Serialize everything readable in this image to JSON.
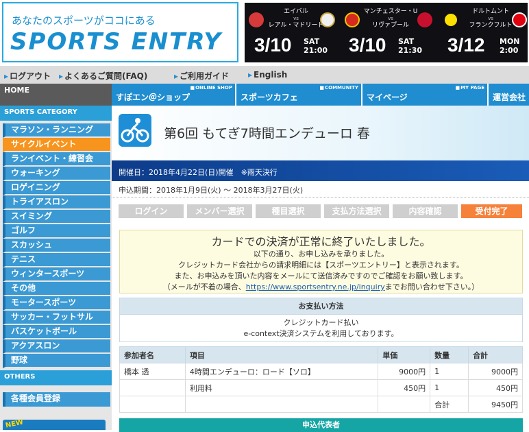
{
  "header": {
    "tagline": "あなたのスポーツがココにある",
    "logo": "SPORTS ENTRY",
    "banner": [
      {
        "home": "エイバル",
        "away": "レアル・マドリード",
        "vs": "vs",
        "date": "3/10",
        "day": "SAT",
        "time": "21:00",
        "crest_a": "#d63a3a",
        "crest_b": "#f0f0f0"
      },
      {
        "home": "マンチェスター・U",
        "away": "リヴァプール",
        "vs": "vs",
        "date": "3/10",
        "day": "SAT",
        "time": "21:30",
        "crest_a": "#d52b1e",
        "crest_b": "#c8102e"
      },
      {
        "home": "ドルトムント",
        "away": "フランクフルト",
        "vs": "vs",
        "date": "3/12",
        "day": "MON",
        "time": "2:00",
        "crest_a": "#fde100",
        "crest_b": "#e1000f"
      }
    ]
  },
  "util": {
    "logout": "ログアウト",
    "faq": "よくあるご質問(FAQ)",
    "guide": "ご利用ガイド",
    "english": "English"
  },
  "sidebar": {
    "home": "HOME",
    "category_head": "SPORTS CATEGORY",
    "categories": [
      "マラソン・ランニング",
      "サイクルイベント",
      "ランイベント・練習会",
      "ウォーキング",
      "ロゲイニング",
      "トライアスロン",
      "スイミング",
      "ゴルフ",
      "スカッシュ",
      "テニス",
      "ウィンタースポーツ",
      "その他",
      "モータースポーツ",
      "サッカー・フットサル",
      "バスケットボール",
      "アクアスロン",
      "野球"
    ],
    "others_head": "OTHERS",
    "register": "各種会員登録",
    "new_badge": "NEW"
  },
  "nav": [
    {
      "sub": "ONLINE SHOP",
      "label": "すぽエン＠ショップ"
    },
    {
      "sub": "COMMUNITY",
      "label": "スポーツカフェ"
    },
    {
      "sub": "MY PAGE",
      "label": "マイページ"
    },
    {
      "sub": "",
      "label": "運営会社"
    }
  ],
  "event": {
    "title": "第6回 もてぎ7時間エンデューロ 春",
    "date_line": "開催日：2018年4月22日(日)開催　※雨天決行",
    "period": "申込期間：2018年1月9日(火) 〜 2018年3月27日(火)"
  },
  "steps": [
    "ログイン",
    "メンバー選択",
    "種目選択",
    "支払方法選択",
    "内容確認",
    "受付完了"
  ],
  "success": {
    "title": "カードでの決済が正常に終了いたしました。",
    "lines": [
      "以下の通り、お申し込みを承りました。",
      "クレジットカード会社からの請求明細には【スポーツエントリー】と表示されます。",
      "また、お申込みを頂いた内容をメールにて送信済みですのでご確認をお願い致します。"
    ],
    "line4_before": "（メールが不着の場合、",
    "line4_link": "https://www.sportsentry.ne.jp/inquiry",
    "line4_after": "までお問い合わせ下さい。）"
  },
  "payment": {
    "head": "お支払い方法",
    "method": "クレジットカード払い",
    "note": "e-context決済システムを利用しております。"
  },
  "order": {
    "headers": [
      "参加者名",
      "項目",
      "単価",
      "数量",
      "合計"
    ],
    "rows": [
      [
        "橋本 透",
        "4時間エンデューロ：ロード【ソロ】",
        "9000円",
        "1",
        "9000円"
      ],
      [
        "",
        "利用料",
        "450円",
        "1",
        "450円"
      ]
    ],
    "total_label": "合計",
    "total_value": "9450円"
  },
  "applicant_head": "申込代表者"
}
